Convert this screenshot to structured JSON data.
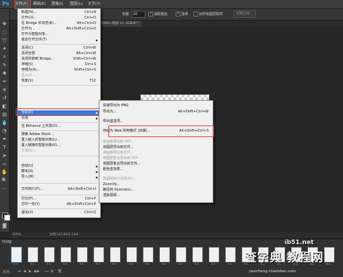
{
  "app": {
    "logo": "Ps"
  },
  "menubar": [
    {
      "label": "文件(F)"
    },
    {
      "label": "编辑(E)"
    },
    {
      "label": "图像(I)"
    },
    {
      "label": "图层(L)"
    },
    {
      "label": "文字(Y)"
    }
  ],
  "options": {
    "tolerance_label": "容差:",
    "tolerance_value": "20",
    "antialias_label": "消除锯齿",
    "contiguous_label": "连续",
    "sample_all_label": "对所有图层取样",
    "refine_button": "调整边缘..."
  },
  "document_tab": {
    "label": "100% (图层 11, RGB/8) *"
  },
  "file_menu": {
    "items": [
      {
        "label": "新建(N)...",
        "shortcut": "Ctrl+N"
      },
      {
        "label": "打开(O)...",
        "shortcut": "Ctrl+O"
      },
      {
        "label": "在 Bridge 中浏览(B)...",
        "shortcut": "Alt+Ctrl+O"
      },
      {
        "label": "打开为...",
        "shortcut": "Alt+Shift+Ctrl+O"
      },
      {
        "label": "打开为智能对象...",
        "shortcut": ""
      },
      {
        "label": "最近打开文件(T)",
        "shortcut": ""
      },
      {
        "label": "关闭(C)",
        "shortcut": "Ctrl+W"
      },
      {
        "label": "关闭全部",
        "shortcut": "Alt+Ctrl+W"
      },
      {
        "label": "关闭并转到 Bridge...",
        "shortcut": "Shift+Ctrl+W"
      },
      {
        "label": "存储(S)",
        "shortcut": "Ctrl+S"
      },
      {
        "label": "存储为(A)...",
        "shortcut": "Shift+Ctrl+S"
      },
      {
        "label": "签入(I)...",
        "shortcut": ""
      },
      {
        "label": "恢复(V)",
        "shortcut": "F12"
      },
      {
        "label": "导出(E)",
        "shortcut": ""
      },
      {
        "label": "生成",
        "shortcut": ""
      },
      {
        "label": "在 Behance 上共享(D)...",
        "shortcut": ""
      },
      {
        "label": "搜索 Adobe Stock...",
        "shortcut": ""
      },
      {
        "label": "置入嵌入的智能对象(L)...",
        "shortcut": ""
      },
      {
        "label": "置入链接的智能对象(K)...",
        "shortcut": ""
      },
      {
        "label": "打包(G)...",
        "shortcut": ""
      },
      {
        "label": "自动(U)",
        "shortcut": ""
      },
      {
        "label": "脚本(R)",
        "shortcut": ""
      },
      {
        "label": "导入(M)",
        "shortcut": ""
      },
      {
        "label": "文件简介(F)...",
        "shortcut": "Alt+Shift+Ctrl+I"
      },
      {
        "label": "打印(P)...",
        "shortcut": "Ctrl+P"
      },
      {
        "label": "打印一份(Y)",
        "shortcut": "Alt+Shift+Ctrl+P"
      },
      {
        "label": "退出(X)",
        "shortcut": "Ctrl+Q"
      }
    ]
  },
  "export_menu": {
    "items": [
      {
        "label": "快速导出为 PNG",
        "shortcut": ""
      },
      {
        "label": "导出为...",
        "shortcut": "Alt+Shift+Ctrl+W"
      },
      {
        "label": "导出首选项...",
        "shortcut": ""
      },
      {
        "label": "存储为 Web 所用格式 (旧版)...",
        "shortcut": "Alt+Shift+Ctrl+S"
      },
      {
        "label": "将画板导出到 PDF...",
        "shortcut": ""
      },
      {
        "label": "将图层导出到文件...",
        "shortcut": ""
      },
      {
        "label": "将画板导出到文件...",
        "shortcut": ""
      },
      {
        "label": "将图层复合导出到 PDF...",
        "shortcut": ""
      },
      {
        "label": "将图层复合导出到文件...",
        "shortcut": ""
      },
      {
        "label": "颜色查找表...",
        "shortcut": ""
      },
      {
        "label": "数据组作为文件(D)...",
        "shortcut": ""
      },
      {
        "label": "Zoomify...",
        "shortcut": ""
      },
      {
        "label": "路径到 Illustrator...",
        "shortcut": ""
      },
      {
        "label": "渲染视频...",
        "shortcut": ""
      }
    ]
  },
  "status": {
    "zoom": "100%",
    "doc": "文档:147.0K/2.11M"
  },
  "timeline": {
    "title": "时间轴",
    "frames": [
      "0.1",
      "0.1",
      "0.1",
      "0.1",
      "0.1",
      "0.1",
      "0.1",
      "0.1",
      "0.1",
      "0.1",
      "0.1",
      "0.1",
      "0.1",
      "0.1",
      "0.1",
      "0.1",
      "0.1",
      "0.1",
      "0.1",
      "0.1"
    ],
    "loop": "永远"
  },
  "watermark": {
    "top": "ib51.net",
    "big": "查字典 教程网",
    "url": "jiaocheng.chazidian.com"
  }
}
